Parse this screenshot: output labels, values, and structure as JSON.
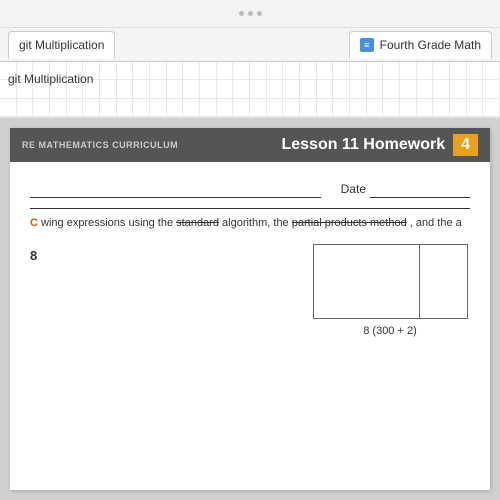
{
  "topBar": {
    "dots": 3
  },
  "tabBar": {
    "tab1": {
      "label": "git Multiplication",
      "iconText": "≡"
    },
    "tab2": {
      "label": "Fourth Grade Math",
      "iconText": "≡"
    }
  },
  "spreadsheet": {
    "label": "git Multiplication"
  },
  "document": {
    "curriculumText": "RE MATHEMATICS CURRICULUM",
    "lessonTitle": "Lesson 11 Homework",
    "lessonNumber": "4",
    "dateLabel": "Date",
    "orangeLabel": "C",
    "instructionPrefix": "wing expressions using the ",
    "method1": "standard",
    "instructionMiddle": " algorithm, the ",
    "method2": "partial products method",
    "instructionSuffix": ", and the a",
    "problemNumber": "8",
    "boxLabel": "8 (300 + 2)"
  }
}
